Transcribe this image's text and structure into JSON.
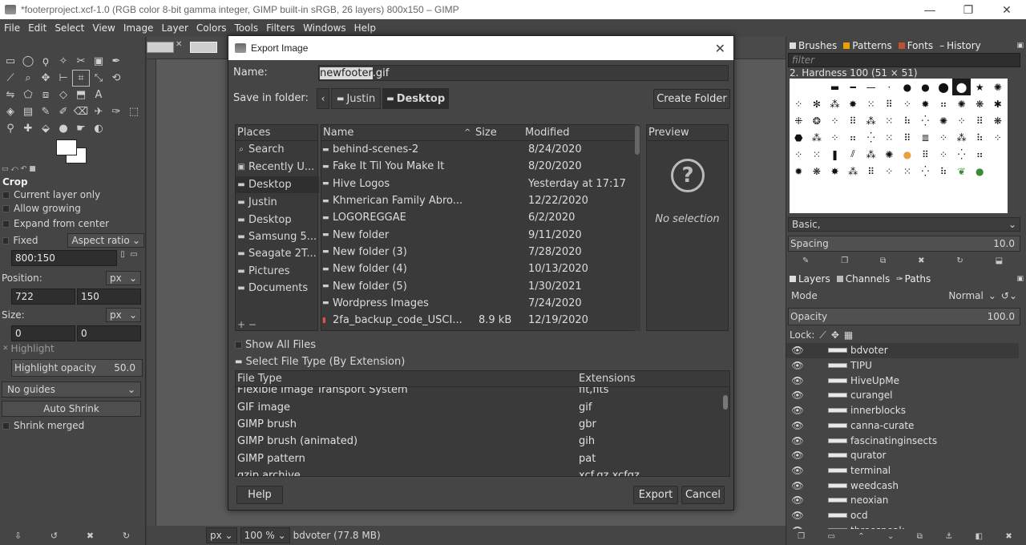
{
  "window": {
    "title": "*footerproject.xcf-1.0 (RGB color 8-bit gamma integer, GIMP built-in sRGB, 26 layers) 800x150 – GIMP",
    "minimize": "—",
    "maximize": "❐",
    "close": "✕"
  },
  "menu": [
    "File",
    "Edit",
    "Select",
    "View",
    "Image",
    "Layer",
    "Colors",
    "Tools",
    "Filters",
    "Windows",
    "Help"
  ],
  "tool_options": {
    "title": "Crop",
    "current_layer_only": "Current layer only",
    "allow_growing": "Allow growing",
    "expand_from_center": "Expand from center",
    "fixed": "Fixed",
    "aspect_ratio": "Aspect ratio",
    "ratio_value": "800:150",
    "position_label": "Position:",
    "position_unit": "px",
    "position_x": "722",
    "position_y": "150",
    "size_label": "Size:",
    "size_unit": "px",
    "size_w": "0",
    "size_h": "0",
    "highlight": "Highlight",
    "highlight_opacity_label": "Highlight opacity",
    "highlight_opacity_value": "50.0",
    "guides": "No guides",
    "auto_shrink": "Auto Shrink",
    "shrink_merged": "Shrink merged"
  },
  "status": {
    "unit": "px",
    "zoom": "100 %",
    "info": "bdvoter (77.8 MB)"
  },
  "brushes": {
    "tabs": [
      "Brushes",
      "Patterns",
      "Fonts",
      "History"
    ],
    "filter_placeholder": "filter",
    "selected_brush": "2. Hardness 100 (51 × 51)",
    "tag": "Basic,",
    "spacing_label": "Spacing",
    "spacing_value": "10.0"
  },
  "layers": {
    "tabs": [
      "Layers",
      "Channels",
      "Paths"
    ],
    "mode_label": "Mode",
    "mode_value": "Normal",
    "opacity_label": "Opacity",
    "opacity_value": "100.0",
    "lock_label": "Lock:",
    "items": [
      "bdvoter",
      "TIPU",
      "HiveUpMe",
      "curangel",
      "innerblocks",
      "canna-curate",
      "fascinatinginsects",
      "qurator",
      "terminal",
      "weedcash",
      "neoxian",
      "ocd",
      "threespeak"
    ]
  },
  "dialog": {
    "title": "Export Image",
    "name_label": "Name:",
    "name_value": "newfooter.gif",
    "name_selected": "newfooter",
    "name_rest": ".gif",
    "save_in_label": "Save in folder:",
    "crumbs": [
      "Justin",
      "Desktop"
    ],
    "create_folder": "Create Folder",
    "places_header": "Places",
    "places": [
      "Search",
      "Recently U...",
      "Desktop",
      "Justin",
      "Desktop",
      "Samsung 5...",
      "Seagate 2T...",
      "Pictures",
      "Documents"
    ],
    "places_selected": 2,
    "col_name": "Name",
    "col_size": "Size",
    "col_modified": "Modified",
    "files": [
      {
        "name": "behind-scenes-2",
        "size": "",
        "modified": "8/24/2020"
      },
      {
        "name": "Fake It Til You Make It",
        "size": "",
        "modified": "8/20/2020"
      },
      {
        "name": "Hive Logos",
        "size": "",
        "modified": "Yesterday at 17:17"
      },
      {
        "name": "Khmerican Family Abro...",
        "size": "",
        "modified": "12/22/2020"
      },
      {
        "name": "LOGOREGGAE",
        "size": "",
        "modified": "6/2/2020"
      },
      {
        "name": "New folder",
        "size": "",
        "modified": "9/11/2020"
      },
      {
        "name": "New folder (3)",
        "size": "",
        "modified": "7/28/2020"
      },
      {
        "name": "New folder (4)",
        "size": "",
        "modified": "10/13/2020"
      },
      {
        "name": "New folder (5)",
        "size": "",
        "modified": "1/30/2021"
      },
      {
        "name": "Wordpress Images",
        "size": "",
        "modified": "7/24/2020"
      },
      {
        "name": "2fa_backup_code_USCI...",
        "size": "8.9 kB",
        "modified": "12/19/2020"
      }
    ],
    "preview_header": "Preview",
    "no_selection": "No selection",
    "show_all_files": "Show All Files",
    "select_file_type": "Select File Type (By Extension)",
    "col_file_type": "File Type",
    "col_extensions": "Extensions",
    "file_types": [
      {
        "type": "Flexible Image Transport System",
        "ext": "fit,fits"
      },
      {
        "type": "GIF image",
        "ext": "gif"
      },
      {
        "type": "GIMP brush",
        "ext": "gbr"
      },
      {
        "type": "GIMP brush (animated)",
        "ext": "gih"
      },
      {
        "type": "GIMP pattern",
        "ext": "pat"
      },
      {
        "type": "gzip archive",
        "ext": "xcf.gz,xcfgz"
      }
    ],
    "help": "Help",
    "export": "Export",
    "cancel": "Cancel"
  }
}
